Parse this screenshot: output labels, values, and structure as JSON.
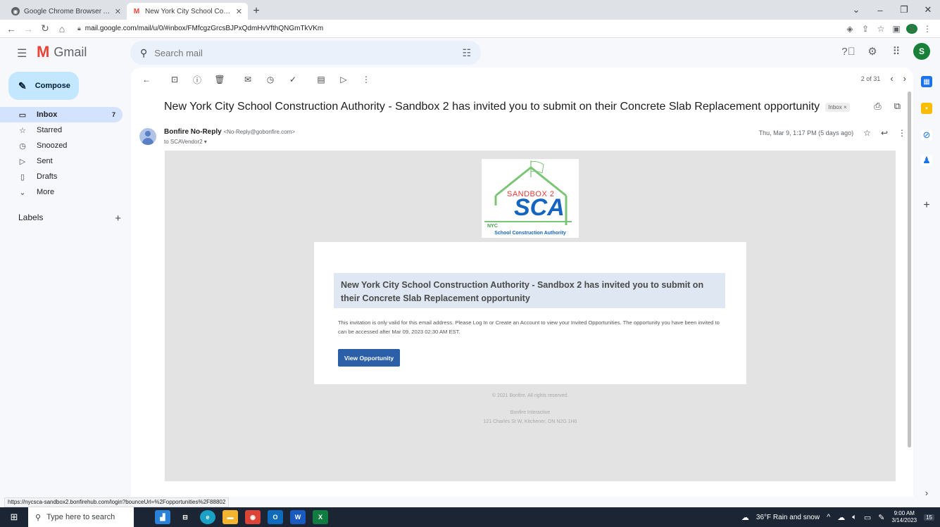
{
  "browser": {
    "tabs": [
      {
        "title": "Google Chrome Browser Applicat",
        "active": false
      },
      {
        "title": "New York City School Constructi",
        "active": true
      }
    ],
    "url": "mail.google.com/mail/u/0/#inbox/FMfcgzGrcsBJPxQdmHvVfthQNGmTkVKm",
    "status_url": "https://nycsca-sandbox2.bonfirehub.com/login?bounceUrl=%2Fopportunities%2F88802"
  },
  "gmail": {
    "app_name": "Gmail",
    "search_placeholder": "Search mail",
    "avatar_letter": "S",
    "compose_label": "Compose",
    "nav": [
      {
        "label": "Inbox",
        "count": "7",
        "icon": "inbox-icon",
        "glyph": "▭"
      },
      {
        "label": "Starred",
        "count": "",
        "icon": "star-icon",
        "glyph": "☆"
      },
      {
        "label": "Snoozed",
        "count": "",
        "icon": "clock-icon",
        "glyph": "◷"
      },
      {
        "label": "Sent",
        "count": "",
        "icon": "send-icon",
        "glyph": "▷"
      },
      {
        "label": "Drafts",
        "count": "",
        "icon": "draft-icon",
        "glyph": "▯"
      },
      {
        "label": "More",
        "count": "",
        "icon": "chevron-down-icon",
        "glyph": "⌄"
      }
    ],
    "labels_heading": "Labels",
    "pager": "2 of 31"
  },
  "email": {
    "subject": "New York City School Construction Authority - Sandbox 2 has invited you to submit on their Concrete Slab Replacement opportunity",
    "label_chip": "Inbox ×",
    "sender_name": "Bonfire No-Reply",
    "sender_email": "<No-Reply@gobonfire.com>",
    "to": "to SCAVendor2 ▾",
    "date": "Thu, Mar 9, 1:17 PM (5 days ago)",
    "logo": {
      "sandbox_text": "SANDBOX 2",
      "sca_text": "SCA",
      "nyc_text": "NYC",
      "full_name": "School Construction Authority"
    },
    "callout": "New York City School Construction Authority - Sandbox 2 has invited you to submit on their Concrete Slab Replacement opportunity",
    "body_text": "This invitation is only valid for this email address. Please Log In or Create an Account to view your Invited Opportunities. The opportunity you have been invited to can be accessed after Mar 09, 2023 02:30 AM EST.",
    "button_label": "View Opportunity",
    "footer_copyright": "© 2021 Bonfire. All rights reserved.",
    "footer_company": "Bonfire Interactive",
    "footer_address": "121 Charles St W, Kitchener, ON N2G 1H6"
  },
  "taskbar": {
    "search_placeholder": "Type here to search",
    "weather": "36°F Rain and snow",
    "time": "9:00 AM",
    "date": "3/14/2023",
    "notification_count": "15"
  }
}
